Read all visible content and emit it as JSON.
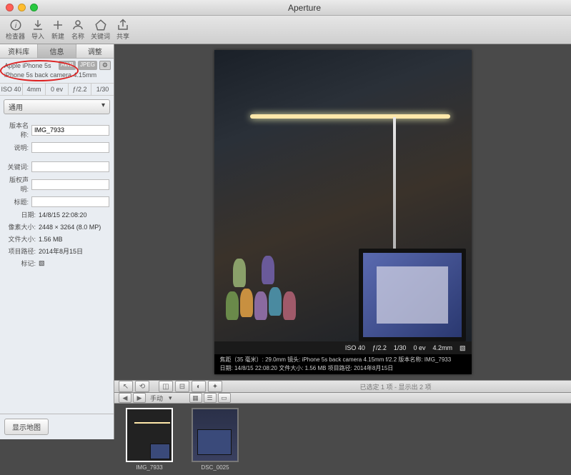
{
  "app_title": "Aperture",
  "toolbar": [
    {
      "name": "inspector-icon",
      "label": "检查器"
    },
    {
      "name": "import-icon",
      "label": "导入"
    },
    {
      "name": "new-icon",
      "label": "新建"
    },
    {
      "name": "name-icon",
      "label": "名称"
    },
    {
      "name": "keywords-icon",
      "label": "关键词"
    },
    {
      "name": "share-icon",
      "label": "共享"
    }
  ],
  "sidebar": {
    "tabs": [
      "资料库",
      "信息",
      "调整"
    ],
    "active_tab": 1,
    "camera_info": {
      "line1": "Apple iPhone 5s",
      "line2": "iPhone 5s back camera 4.15mm",
      "badge1": "AWB",
      "badge2": "JPEG",
      "badge3": "⚙"
    },
    "exif": {
      "iso": "ISO 40",
      "focal": "4mm",
      "ev": "0 ev",
      "aperture": "ƒ/2.2",
      "shutter": "1/30"
    },
    "preset_popup": "通用",
    "fields": {
      "version_name": {
        "label": "版本名称:",
        "value": "IMG_7933"
      },
      "caption": {
        "label": "说明:",
        "value": ""
      },
      "keywords": {
        "label": "关键词:",
        "value": ""
      },
      "copyright": {
        "label": "版权声明:",
        "value": ""
      },
      "title": {
        "label": "标题:",
        "value": ""
      },
      "date": {
        "label": "日期:",
        "value": "14/8/15 22:08:20"
      },
      "dimensions": {
        "label": "像素大小:",
        "value": "2448 × 3264 (8.0 MP)"
      },
      "filesize": {
        "label": "文件大小:",
        "value": "1.56 MB"
      },
      "project_path": {
        "label": "项目路径:",
        "value": "2014年8月15日"
      },
      "badges": {
        "label": "标记:",
        "value": "▧"
      }
    },
    "show_map_btn": "显示地图"
  },
  "overlay": {
    "iso": "ISO 40",
    "aperture": "ƒ/2.2",
    "shutter": "1/30",
    "ev": "0 ev",
    "focal": "4.2mm",
    "info1": "焦距（35 毫米）: 29.0mm 镜头: iPhone 5s back camera 4.15mm f/2.2  版本名称: IMG_7933",
    "info2": "日期: 14/8/15 22:08:20 文件大小: 1.56 MB  项目路径: 2014年8月15日"
  },
  "cursor_label": "手动",
  "status_text": "已选定 1 项 - 显示出 2 项",
  "thumbnails": [
    {
      "name": "IMG_7933",
      "selected": true
    },
    {
      "name": "DSC_0025",
      "selected": false
    }
  ]
}
